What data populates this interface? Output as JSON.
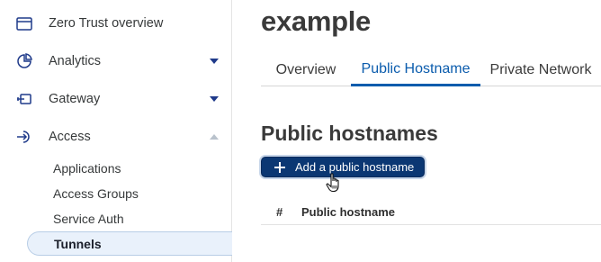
{
  "sidebar": {
    "items": [
      {
        "label": "Zero Trust overview",
        "icon": "window-icon"
      },
      {
        "label": "Analytics",
        "icon": "pie-chart-icon",
        "expanded": false
      },
      {
        "label": "Gateway",
        "icon": "gateway-icon",
        "expanded": false
      },
      {
        "label": "Access",
        "icon": "access-icon",
        "expanded": true
      }
    ],
    "access_subitems": [
      {
        "label": "Applications"
      },
      {
        "label": "Access Groups"
      },
      {
        "label": "Service Auth"
      },
      {
        "label": "Tunnels",
        "active": true
      }
    ]
  },
  "main": {
    "title": "example",
    "tabs": [
      {
        "label": "Overview"
      },
      {
        "label": "Public Hostname",
        "active": true
      },
      {
        "label": "Private Network"
      }
    ],
    "section_title": "Public hostnames",
    "add_button": {
      "label": "Add a public hostname",
      "icon": "plus-icon"
    },
    "table": {
      "columns": [
        "#",
        "Public hostname"
      ]
    }
  },
  "colors": {
    "accent": "#0b5cad",
    "button_bg": "#0b3773",
    "active_nav_bg": "#e9f1fb"
  }
}
